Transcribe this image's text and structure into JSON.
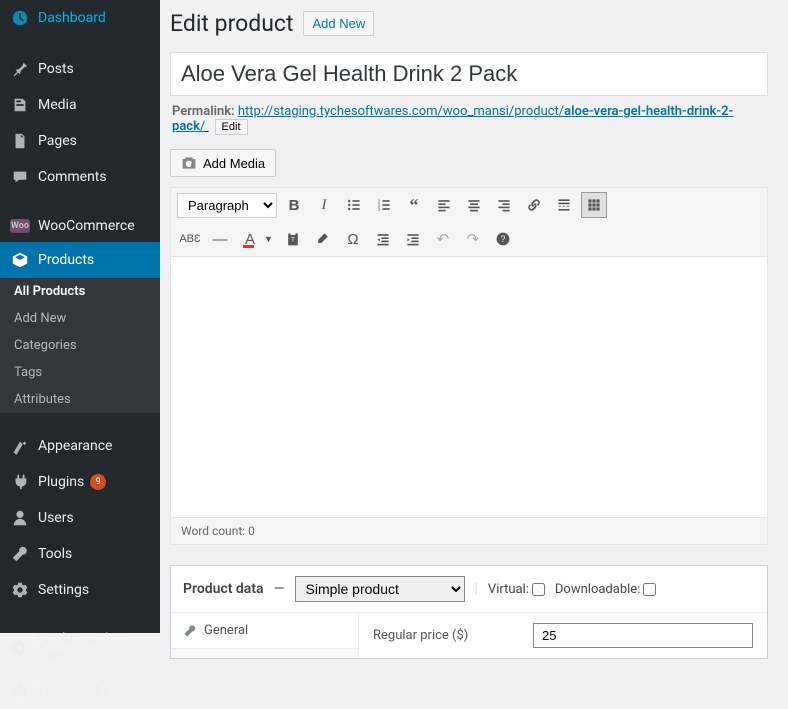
{
  "sidebar": {
    "items": [
      {
        "label": "Dashboard",
        "icon": "dashboard"
      },
      {
        "label": "Posts",
        "icon": "pin"
      },
      {
        "label": "Media",
        "icon": "media"
      },
      {
        "label": "Pages",
        "icon": "pages"
      },
      {
        "label": "Comments",
        "icon": "comments"
      },
      {
        "label": "WooCommerce",
        "icon": "woo"
      },
      {
        "label": "Products",
        "icon": "products",
        "active": true
      },
      {
        "label": "Appearance",
        "icon": "appearance"
      },
      {
        "label": "Plugins",
        "icon": "plugins",
        "badge": "9"
      },
      {
        "label": "Users",
        "icon": "users"
      },
      {
        "label": "Tools",
        "icon": "tools"
      },
      {
        "label": "Settings",
        "icon": "settings"
      },
      {
        "label": "Product Delivery Date",
        "icon": "settings2"
      },
      {
        "label": "LiteSpeed Cache",
        "icon": "litespeed"
      }
    ],
    "products_submenu": [
      {
        "label": "All Products",
        "active": true
      },
      {
        "label": "Add New"
      },
      {
        "label": "Categories"
      },
      {
        "label": "Tags"
      },
      {
        "label": "Attributes"
      }
    ]
  },
  "header": {
    "title": "Edit product",
    "add_new": "Add New"
  },
  "title_input": "Aloe Vera Gel Health Drink 2 Pack",
  "permalink": {
    "label": "Permalink:",
    "url_base": "http://staging.tychesoftwares.com/woo_mansi/product/",
    "slug": "aloe-vera-gel-health-drink-2-pack",
    "trailing": "/",
    "edit_label": "Edit"
  },
  "editor": {
    "add_media": "Add Media",
    "format_select": "Paragraph",
    "word_count_label": "Word count: 0"
  },
  "product_data": {
    "label": "Product data",
    "dash": "—",
    "type_select": "Simple product",
    "virtual_label": "Virtual:",
    "downloadable_label": "Downloadable:",
    "tab_general": "General",
    "regular_price_label": "Regular price ($)",
    "regular_price_value": "25"
  }
}
